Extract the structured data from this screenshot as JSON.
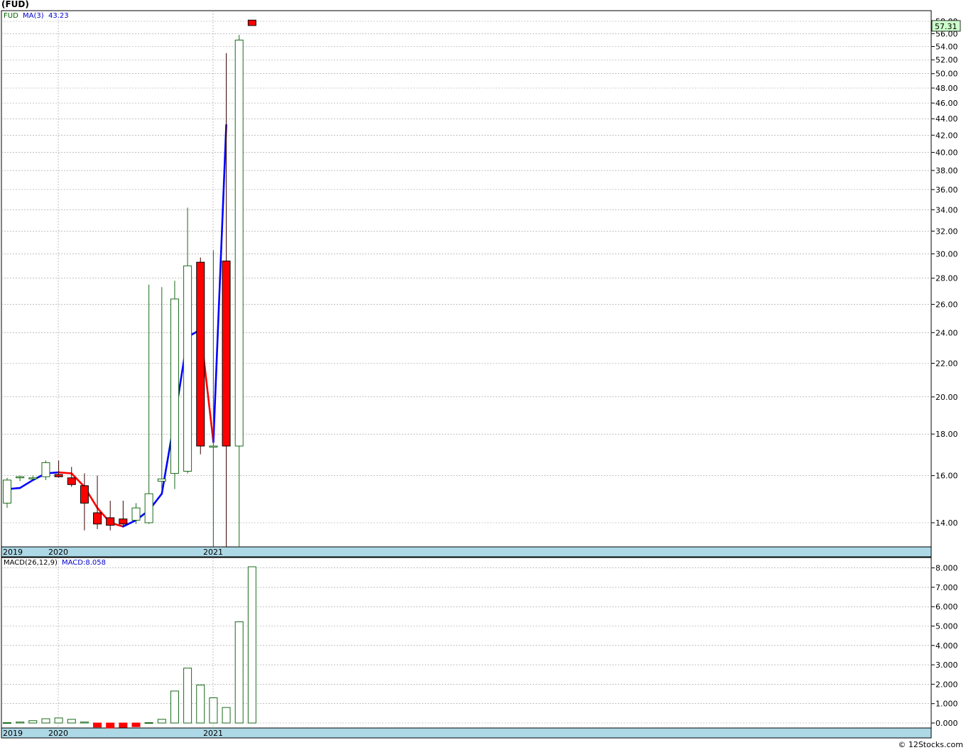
{
  "title": "(FUD)",
  "credit": "© 12Stocks.com",
  "price_panel": {
    "symbol_label": "FUD",
    "ma_label": "MA(3)",
    "ma_value": "43.23",
    "last_price": "57.31",
    "y_ticks": [
      "58.00",
      "56.00",
      "54.00",
      "52.00",
      "50.00",
      "48.00",
      "46.00",
      "44.00",
      "42.00",
      "40.00",
      "38.00",
      "36.00",
      "34.00",
      "32.00",
      "30.00",
      "28.00",
      "26.00",
      "24.00",
      "22.00",
      "20.00",
      "18.00",
      "16.00",
      "14.00"
    ]
  },
  "macd_panel": {
    "label": "MACD(26,12,9)",
    "value_label": "MACD:8.058",
    "y_ticks": [
      "8.000",
      "7.000",
      "6.000",
      "5.000",
      "4.000",
      "3.000",
      "2.000",
      "1.000",
      "0.000"
    ]
  },
  "x_labels": [
    "2019",
    "2020",
    "2021"
  ],
  "colors": {
    "up": "#1a6b1a",
    "down_fill": "#ff0000",
    "ma_up": "#0000ff",
    "ma_down": "#ff0000",
    "axis_band": "#add8e6",
    "price_badge": "#ccffcc"
  },
  "chart_data": [
    {
      "type": "candlestick",
      "scale": "log",
      "ylim": [
        13,
        60
      ],
      "series": [
        {
          "name": "FUD",
          "candles": [
            {
              "o": 14.8,
              "h": 15.9,
              "l": 14.6,
              "c": 15.8
            },
            {
              "o": 15.95,
              "h": 16.0,
              "l": 15.75,
              "c": 15.95
            },
            {
              "o": 15.9,
              "h": 16.0,
              "l": 15.8,
              "c": 15.9
            },
            {
              "o": 15.95,
              "h": 16.7,
              "l": 15.8,
              "c": 16.6
            },
            {
              "o": 16.05,
              "h": 16.7,
              "l": 15.9,
              "c": 15.95
            },
            {
              "o": 15.9,
              "h": 16.4,
              "l": 15.5,
              "c": 15.6
            },
            {
              "o": 15.55,
              "h": 16.1,
              "l": 13.7,
              "c": 14.8
            },
            {
              "o": 14.4,
              "h": 16.0,
              "l": 13.75,
              "c": 13.95
            },
            {
              "o": 14.2,
              "h": 14.9,
              "l": 13.7,
              "c": 13.9
            },
            {
              "o": 14.15,
              "h": 14.9,
              "l": 13.85,
              "c": 13.95
            },
            {
              "o": 14.1,
              "h": 14.8,
              "l": 13.95,
              "c": 14.6
            },
            {
              "o": 14.0,
              "h": 27.5,
              "l": 13.95,
              "c": 15.2
            },
            {
              "o": 15.75,
              "h": 27.3,
              "l": 15.3,
              "c": 15.85
            },
            {
              "o": 16.1,
              "h": 27.8,
              "l": 15.4,
              "c": 26.4
            },
            {
              "o": 16.2,
              "h": 34.2,
              "l": 16.1,
              "c": 29.0
            },
            {
              "o": 29.3,
              "h": 29.7,
              "l": 17.0,
              "c": 17.4
            },
            {
              "o": 17.4,
              "h": 30.3,
              "l": 12.0,
              "c": 17.4
            },
            {
              "o": 29.4,
              "h": 53.0,
              "l": 12.0,
              "c": 17.4
            },
            {
              "o": 17.4,
              "h": 55.8,
              "l": 12.0,
              "c": 55.0
            },
            {
              "o": 58.2,
              "h": 58.2,
              "l": 57.31,
              "c": 57.31
            }
          ]
        },
        {
          "name": "MA(3)",
          "values": [
            15.4,
            15.45,
            15.8,
            16.1,
            16.15,
            16.1,
            15.5,
            14.6,
            14.0,
            13.85,
            14.1,
            14.5,
            15.2,
            18.8,
            23.7,
            24.2,
            17.6,
            43.23
          ]
        }
      ]
    },
    {
      "type": "bar",
      "series": [
        {
          "name": "MACD",
          "values": [
            0.02,
            0.05,
            0.12,
            0.22,
            0.26,
            0.19,
            0.05,
            -0.21,
            -0.26,
            -0.22,
            -0.19,
            0.02,
            0.19,
            1.65,
            2.83,
            1.96,
            1.3,
            0.8,
            5.22,
            8.058
          ]
        }
      ],
      "ylim": [
        -0.3,
        8.5
      ]
    }
  ]
}
